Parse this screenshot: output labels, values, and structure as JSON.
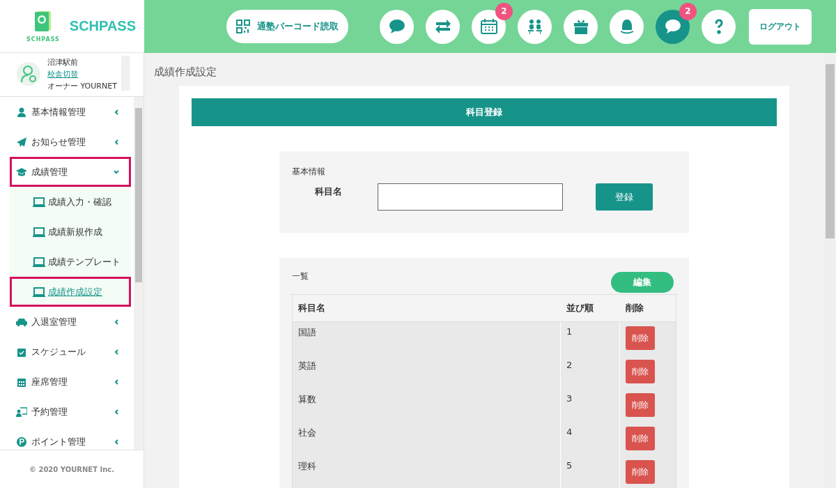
{
  "logo": {
    "mark_text": "SCHPASS",
    "name": "SCHPASS"
  },
  "header": {
    "barcode_button": "通塾バーコード読取",
    "icon_buttons": [
      {
        "kind": "chat",
        "selected": false
      },
      {
        "kind": "swap",
        "selected": false
      },
      {
        "kind": "calendar",
        "selected": false,
        "badge": "2"
      },
      {
        "kind": "meeting",
        "selected": false
      },
      {
        "kind": "gift",
        "selected": false
      },
      {
        "kind": "bell",
        "selected": false
      },
      {
        "kind": "chat",
        "selected": true,
        "badge": "2"
      },
      {
        "kind": "help",
        "selected": false
      }
    ],
    "logout": "ログアウト"
  },
  "account": {
    "school": "沼津駅前",
    "switch_link": "校舎切替",
    "role": "オーナー YOURNET"
  },
  "sidebar": {
    "items": [
      {
        "label": "基本情報管理",
        "kind": "user",
        "expanded": false,
        "highlighted": false
      },
      {
        "label": "お知らせ管理",
        "kind": "send",
        "expanded": false,
        "highlighted": false
      },
      {
        "label": "成績管理",
        "kind": "grades",
        "expanded": true,
        "highlighted": true,
        "children": [
          {
            "label": "成績入力・確認",
            "selected": false,
            "highlighted": false
          },
          {
            "label": "成績新規作成",
            "selected": false,
            "highlighted": false
          },
          {
            "label": "成績テンプレート",
            "selected": false,
            "highlighted": false
          },
          {
            "label": "成績作成設定",
            "selected": true,
            "highlighted": true
          }
        ]
      },
      {
        "label": "入退室管理",
        "kind": "entry",
        "expanded": false,
        "highlighted": false
      },
      {
        "label": "スケジュール",
        "kind": "schedule",
        "expanded": false,
        "highlighted": false
      },
      {
        "label": "座席管理",
        "kind": "seats",
        "expanded": false,
        "highlighted": false
      },
      {
        "label": "予約管理",
        "kind": "booking",
        "expanded": false,
        "highlighted": false
      },
      {
        "label": "ポイント管理",
        "kind": "point",
        "expanded": false,
        "highlighted": false
      }
    ],
    "footer": "© 2020 YOURNET Inc."
  },
  "page_title": "成績作成設定",
  "panel": {
    "title": "科目登録",
    "basic": {
      "heading": "基本情報",
      "field_label": "科目名",
      "register_button": "登録"
    },
    "list": {
      "heading": "一覧",
      "edit_button": "編集",
      "columns": [
        "科目名",
        "並び順",
        "削除"
      ],
      "rows": [
        {
          "name": "国語",
          "order": "1",
          "delete": "削除"
        },
        {
          "name": "英語",
          "order": "2",
          "delete": "削除"
        },
        {
          "name": "算数",
          "order": "3",
          "delete": "削除"
        },
        {
          "name": "社会",
          "order": "4",
          "delete": "削除"
        },
        {
          "name": "理科",
          "order": "5",
          "delete": "削除"
        }
      ]
    }
  }
}
